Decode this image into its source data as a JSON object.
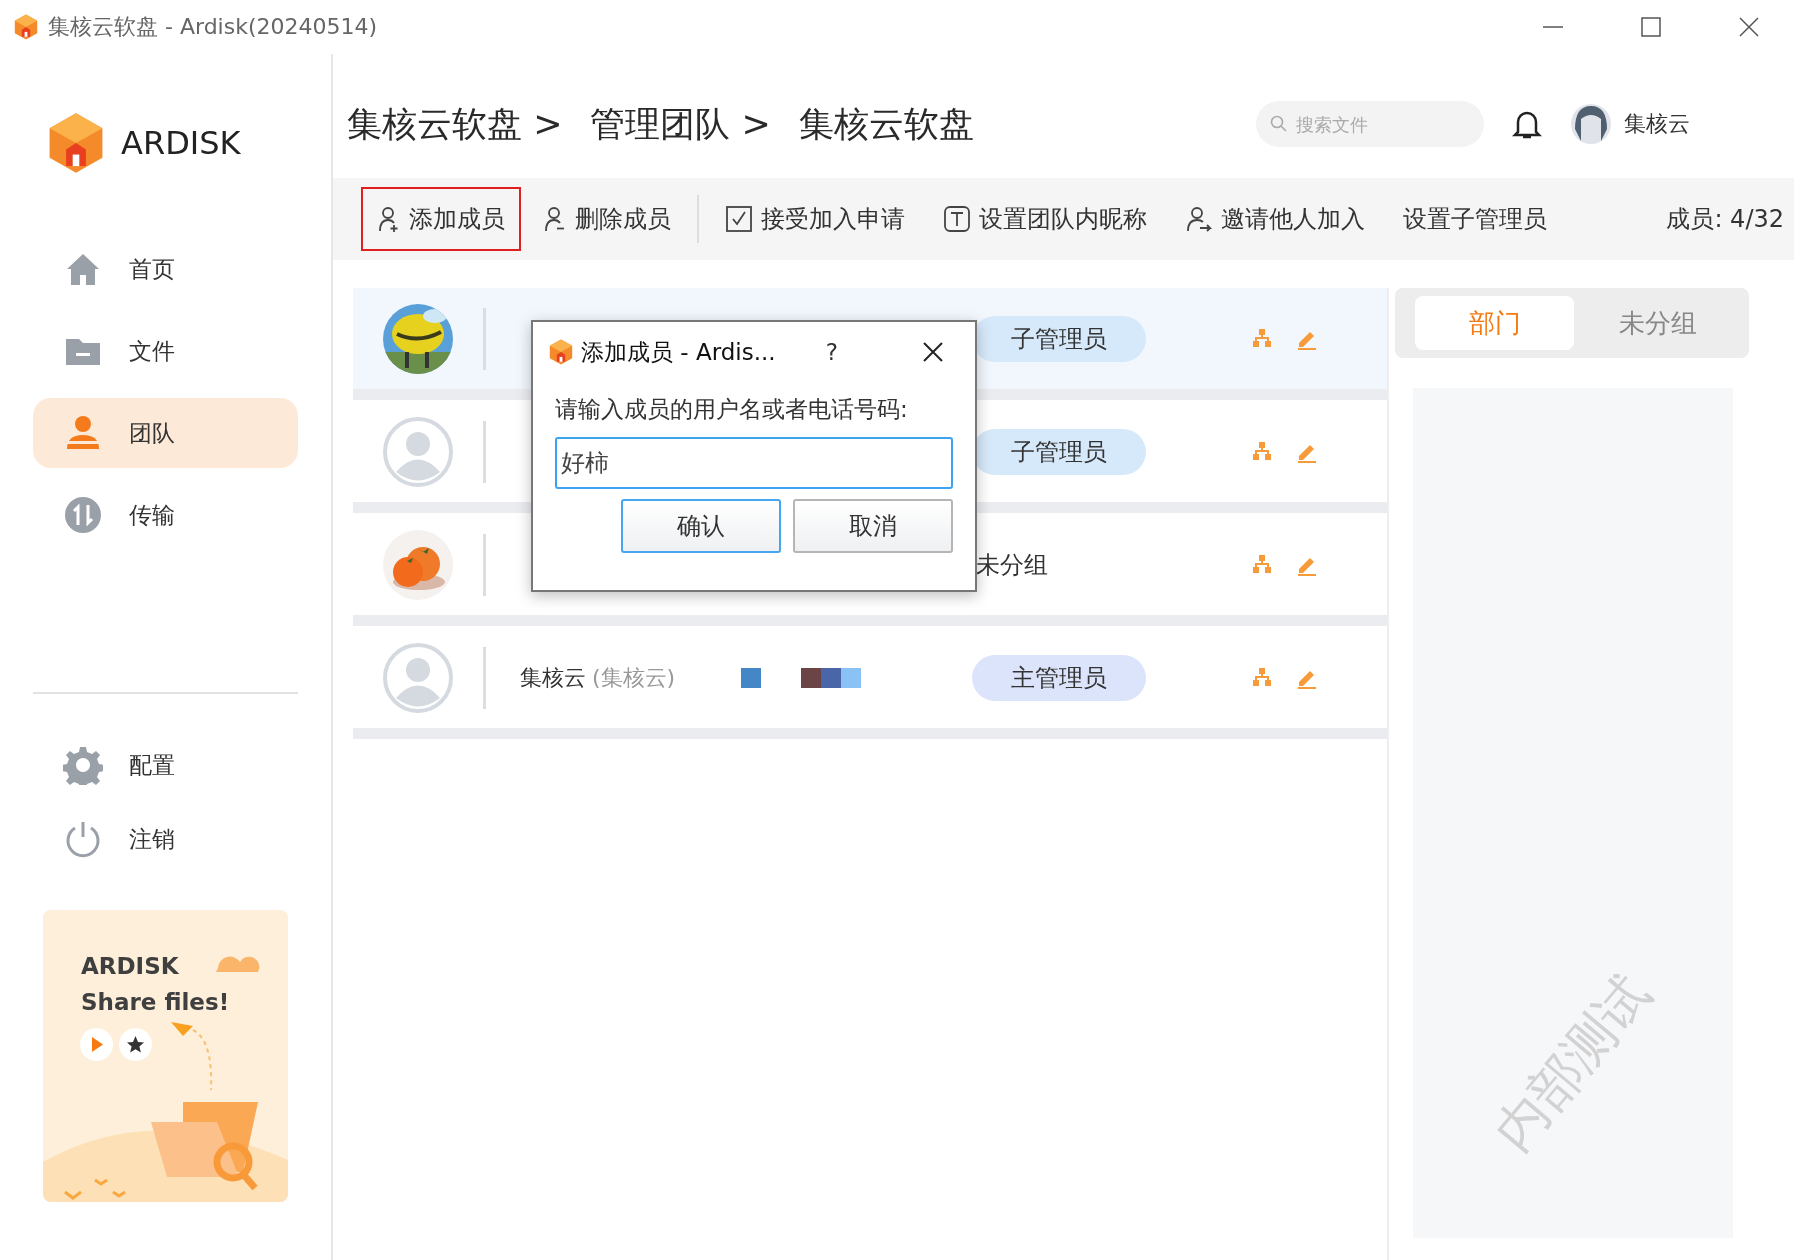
{
  "window": {
    "title": "集核云软盘 - Ardisk(20240514)"
  },
  "sidebar": {
    "logo": "ARDISK",
    "items": [
      {
        "label": "首页",
        "selected": false
      },
      {
        "label": "文件",
        "selected": false
      },
      {
        "label": "团队",
        "selected": true
      },
      {
        "label": "传输",
        "selected": false
      }
    ],
    "bottom_items": [
      {
        "label": "配置"
      },
      {
        "label": "注销"
      }
    ],
    "promo": {
      "title": "ARDISK",
      "subtitle": "Share files!"
    }
  },
  "header": {
    "breadcrumb": [
      "集核云软盘 >",
      "管理团队 >",
      "集核云软盘"
    ],
    "search": {
      "placeholder": "搜索文件"
    },
    "user": "集核云"
  },
  "toolbar": {
    "items": [
      {
        "label": "添加成员",
        "selected": true
      },
      {
        "label": "删除成员",
        "selected": false
      },
      {
        "label": "接受加入申请",
        "selected": false
      },
      {
        "label": "设置团队内昵称",
        "selected": false
      },
      {
        "label": "邀请他人加入",
        "selected": false
      },
      {
        "label": "设置子管理员",
        "selected": false
      }
    ],
    "count": "成员: 4/32"
  },
  "members": [
    {
      "kind": "picture",
      "selected": true,
      "role": {
        "kind": "badge",
        "text": "子管理员",
        "color": "#d6e9fb"
      }
    },
    {
      "kind": "default",
      "selected": false,
      "role": {
        "kind": "badge",
        "text": "子管理员",
        "color": "#d6e9fb"
      }
    },
    {
      "kind": "picture",
      "selected": false,
      "role": {
        "kind": "plain",
        "text": "未分组"
      }
    },
    {
      "kind": "default",
      "selected": false,
      "name": "集核云",
      "nickname": "(集核云)",
      "marks": [
        {
          "color": "#4586c6"
        }
      ],
      "strip": [
        {
          "color": "#6b4545"
        },
        {
          "color": "#4a66a8"
        },
        {
          "color": "#8ac2f5"
        }
      ],
      "role": {
        "kind": "badge",
        "text": "主管理员",
        "color": "#dce4fb"
      }
    }
  ],
  "groups_panel": {
    "tabs": [
      {
        "label": "部门",
        "selected": true
      },
      {
        "label": "未分组",
        "selected": false
      }
    ],
    "watermark": "内部测试"
  },
  "dialog": {
    "title": "添加成员 - Ardis...",
    "help": "?",
    "prompt": "请输入成员的用户名或者电话号码:",
    "value": "好柿",
    "buttons": [
      {
        "label": "确认",
        "default": true
      },
      {
        "label": "取消",
        "default": false
      }
    ]
  }
}
